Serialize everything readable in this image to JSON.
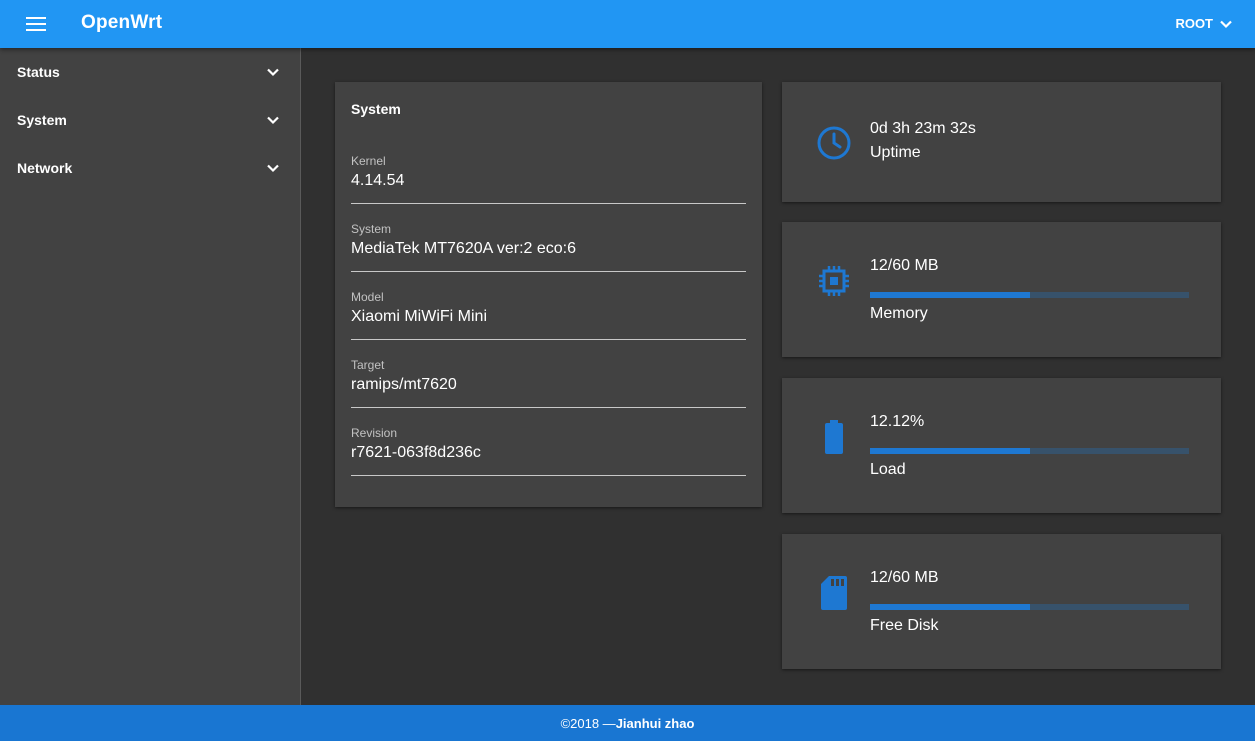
{
  "header": {
    "title": "OpenWrt",
    "user": "ROOT"
  },
  "sidebar": {
    "items": [
      {
        "label": "Status"
      },
      {
        "label": "System"
      },
      {
        "label": "Network"
      }
    ]
  },
  "system_card": {
    "title": "System",
    "fields": [
      {
        "label": "Kernel",
        "value": "4.14.54"
      },
      {
        "label": "System",
        "value": "MediaTek MT7620A ver:2 eco:6"
      },
      {
        "label": "Model",
        "value": "Xiaomi MiWiFi Mini"
      },
      {
        "label": "Target",
        "value": "ramips/mt7620"
      },
      {
        "label": "Revision",
        "value": "r7621-063f8d236c"
      }
    ]
  },
  "stats": {
    "uptime": {
      "value": "0d 3h 23m 32s",
      "label": "Uptime",
      "icon": "clock-icon"
    },
    "memory": {
      "value": "12/60 MB",
      "label": "Memory",
      "icon": "chip-icon",
      "progress": 0.5
    },
    "load": {
      "value": "12.12%",
      "label": "Load",
      "icon": "battery-icon",
      "progress": 0.5
    },
    "disk": {
      "value": "12/60 MB",
      "label": "Free Disk",
      "icon": "sd-card-icon",
      "progress": 0.5
    }
  },
  "footer": {
    "prefix": "©2018 —",
    "author": "Jianhui zhao"
  },
  "colors": {
    "primary": "#2196f3",
    "footer": "#1976d2",
    "accent": "#1e78d2",
    "background": "#303030",
    "card": "#424242"
  }
}
